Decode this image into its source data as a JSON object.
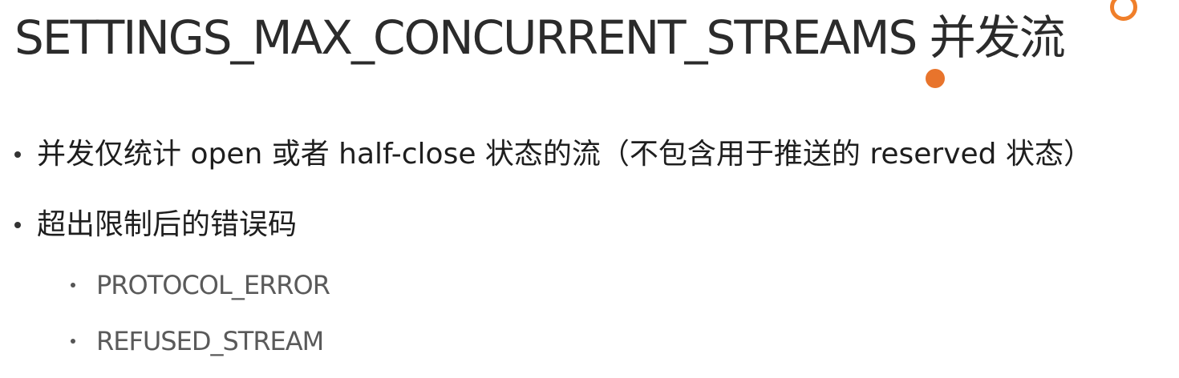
{
  "slide": {
    "title": "SETTINGS_MAX_CONCURRENT_STREAMS 并发流",
    "bullets": [
      {
        "text": "并发仅统计 open 或者 half-close 状态的流（不包含用于推送的 reserved 状态）"
      },
      {
        "text": "超出限制后的错误码"
      }
    ],
    "sub_bullets": [
      {
        "text": "PROTOCOL_ERROR"
      },
      {
        "text": "REFUSED_STREAM"
      }
    ]
  },
  "colors": {
    "accent": "#e8742c",
    "text": "#222222",
    "sub_text": "#5a5a5a",
    "background": "#ffffff"
  }
}
